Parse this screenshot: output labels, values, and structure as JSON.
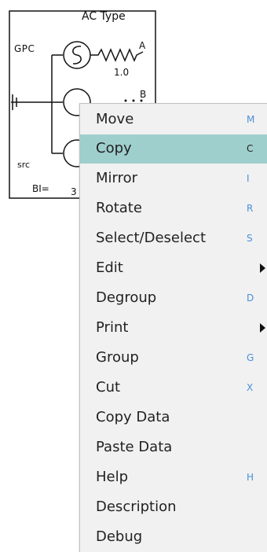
{
  "schematic": {
    "title": "AC Type",
    "gpc_label": "GPC",
    "src_label": "src",
    "bi_label": "BI=",
    "ratio_label": "1.0",
    "port_a": "A",
    "port_b": "B",
    "port_3": "3"
  },
  "menu": {
    "items": [
      {
        "label": "Move",
        "shortcut": "M"
      },
      {
        "label": "Copy",
        "shortcut": "C"
      },
      {
        "label": "Mirror",
        "shortcut": "I"
      },
      {
        "label": "Rotate",
        "shortcut": "R"
      },
      {
        "label": "Select/Deselect",
        "shortcut": "S"
      },
      {
        "label": "Edit",
        "shortcut": ""
      },
      {
        "label": "Degroup",
        "shortcut": "D"
      },
      {
        "label": "Print",
        "shortcut": ""
      },
      {
        "label": "Group",
        "shortcut": "G"
      },
      {
        "label": "Cut",
        "shortcut": "X"
      },
      {
        "label": "Copy Data",
        "shortcut": ""
      },
      {
        "label": "Paste Data",
        "shortcut": ""
      },
      {
        "label": "Help",
        "shortcut": "H"
      },
      {
        "label": "Description",
        "shortcut": ""
      },
      {
        "label": "Debug",
        "shortcut": ""
      }
    ],
    "highlighted_item": "Copy",
    "submenu_items": [
      "Edit",
      "Print"
    ]
  },
  "colors": {
    "menu_background": "#f1f1f1",
    "highlight": "#9fcfcd",
    "shortcut_text": "#4a90d9"
  }
}
